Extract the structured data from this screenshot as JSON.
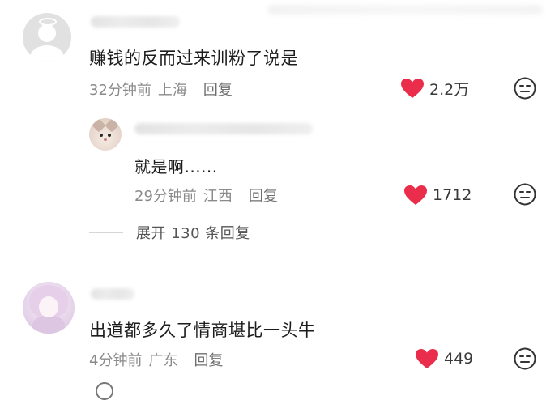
{
  "colors": {
    "heart": "#ea2d4a",
    "meta_text": "#8a8a8a",
    "comment_text": "#1c1c1c"
  },
  "comments": [
    {
      "text": "赚钱的反而过来训粉了说是",
      "time": "32分钟前",
      "location": "上海",
      "reply_label": "回复",
      "likes": "2.2万",
      "avatar_icon": "default-user-avatar-icon"
    },
    {
      "text": "出道都多久了情商堪比一头牛",
      "time": "4分钟前",
      "location": "广东",
      "reply_label": "回复",
      "likes": "449",
      "avatar_icon": "anime-girl-avatar-icon"
    }
  ],
  "reply": {
    "text": "就是啊......",
    "time": "29分钟前",
    "location": "江西",
    "reply_label": "回复",
    "likes": "1712",
    "avatar_icon": "cat-avatar-icon"
  },
  "expand_replies": {
    "label": "展开 130 条回复"
  },
  "icons": {
    "like": "heart-icon",
    "dislike": "neutral-face-icon"
  }
}
